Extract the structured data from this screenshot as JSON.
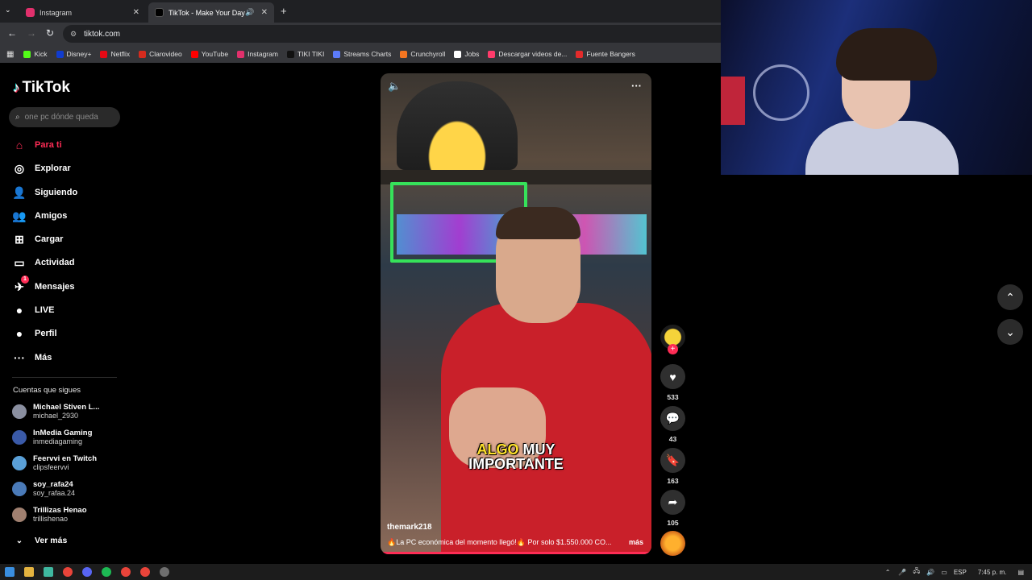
{
  "browser": {
    "tabs": [
      {
        "label": "Instagram",
        "active": false,
        "favicon_color": "#e1306c"
      },
      {
        "label": "TikTok - Make Your Day",
        "active": true,
        "favicon_color": "#000000"
      }
    ],
    "url": "tiktok.com",
    "bookmarks": [
      {
        "label": "Kick",
        "color": "#53fc18"
      },
      {
        "label": "Disney+",
        "color": "#113ccf"
      },
      {
        "label": "Netflix",
        "color": "#e50914"
      },
      {
        "label": "Clarovideo",
        "color": "#d52b1e"
      },
      {
        "label": "YouTube",
        "color": "#ff0000"
      },
      {
        "label": "Instagram",
        "color": "#e1306c"
      },
      {
        "label": "TIKI TIKI",
        "color": "#111111"
      },
      {
        "label": "Streams Charts",
        "color": "#5c7cfa"
      },
      {
        "label": "Crunchyroll",
        "color": "#f47521"
      },
      {
        "label": "Jobs",
        "color": "#ffffff"
      },
      {
        "label": "Descargar videos de...",
        "color": "#ff3b6b"
      },
      {
        "label": "Fuente Bangers",
        "color": "#e32b2b"
      }
    ]
  },
  "tiktok": {
    "logo": "TikTok",
    "search_placeholder": "one pc dónde queda",
    "nav": [
      {
        "label": "Para ti",
        "icon": "home-icon",
        "active": true
      },
      {
        "label": "Explorar",
        "icon": "compass-icon"
      },
      {
        "label": "Siguiendo",
        "icon": "user-follow-icon"
      },
      {
        "label": "Amigos",
        "icon": "friends-icon"
      },
      {
        "label": "Cargar",
        "icon": "upload-icon"
      },
      {
        "label": "Actividad",
        "icon": "activity-icon"
      },
      {
        "label": "Mensajes",
        "icon": "messages-icon",
        "badge": "1"
      },
      {
        "label": "LIVE",
        "icon": "live-icon"
      },
      {
        "label": "Perfil",
        "icon": "profile-icon"
      },
      {
        "label": "Más",
        "icon": "more-icon"
      }
    ],
    "following_title": "Cuentas que sigues",
    "following": [
      {
        "name": "Michael Stiven L...",
        "username": "michael_2930"
      },
      {
        "name": "InMedia Gaming",
        "username": "inmediagaming"
      },
      {
        "name": "Feervvi en Twitch",
        "username": "clipsfeervvi"
      },
      {
        "name": "soy_rafa24",
        "username": "soy_rafaa.24"
      },
      {
        "name": "Trillizas Henao",
        "username": "trillishenao"
      }
    ],
    "see_more": "Ver más"
  },
  "video": {
    "overlay_word1": "ALGO",
    "overlay_word2": "MUY",
    "overlay_line2": "IMPORTANTE",
    "username": "themark218",
    "description": "🔥La PC económica del momento llegó!🔥 Por solo $1.550.000 CO...",
    "more": "más"
  },
  "actions": {
    "likes": "533",
    "comments": "43",
    "saves": "163",
    "shares": "105"
  },
  "taskbar": {
    "language": "ESP",
    "time": "7:45 p. m."
  },
  "colors": {
    "accent": "#fe2c55",
    "background": "#000000"
  }
}
